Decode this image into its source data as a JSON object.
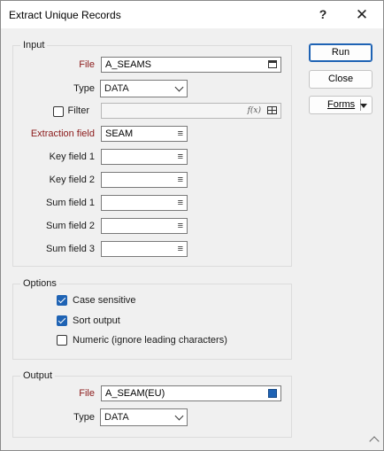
{
  "window": {
    "title": "Extract Unique Records",
    "help_label": "?",
    "close_label": "✕"
  },
  "buttons": {
    "run": "Run",
    "close": "Close",
    "forms": "Forms"
  },
  "input": {
    "group_label": "Input",
    "file_label": "File",
    "file_value": "A_SEAMS",
    "type_label": "Type",
    "type_value": "DATA",
    "filter_label": "Filter",
    "filter_value": "",
    "filter_fx": "f(x)",
    "extraction_label": "Extraction field",
    "extraction_value": "SEAM",
    "key1_label": "Key field 1",
    "key1_value": "",
    "key2_label": "Key field 2",
    "key2_value": "",
    "sum1_label": "Sum field 1",
    "sum1_value": "",
    "sum2_label": "Sum field 2",
    "sum2_value": "",
    "sum3_label": "Sum field 3",
    "sum3_value": ""
  },
  "options": {
    "group_label": "Options",
    "case_sensitive": {
      "label": "Case sensitive",
      "checked": true
    },
    "sort_output": {
      "label": "Sort output",
      "checked": true
    },
    "numeric": {
      "label": "Numeric (ignore leading characters)",
      "checked": false
    }
  },
  "output": {
    "group_label": "Output",
    "file_label": "File",
    "file_value": "A_SEAM(EU)",
    "type_label": "Type",
    "type_value": "DATA"
  },
  "icons": {
    "list_icon": "≡",
    "file_browse": "window-icon",
    "color_swatch": "#1f63b4"
  }
}
